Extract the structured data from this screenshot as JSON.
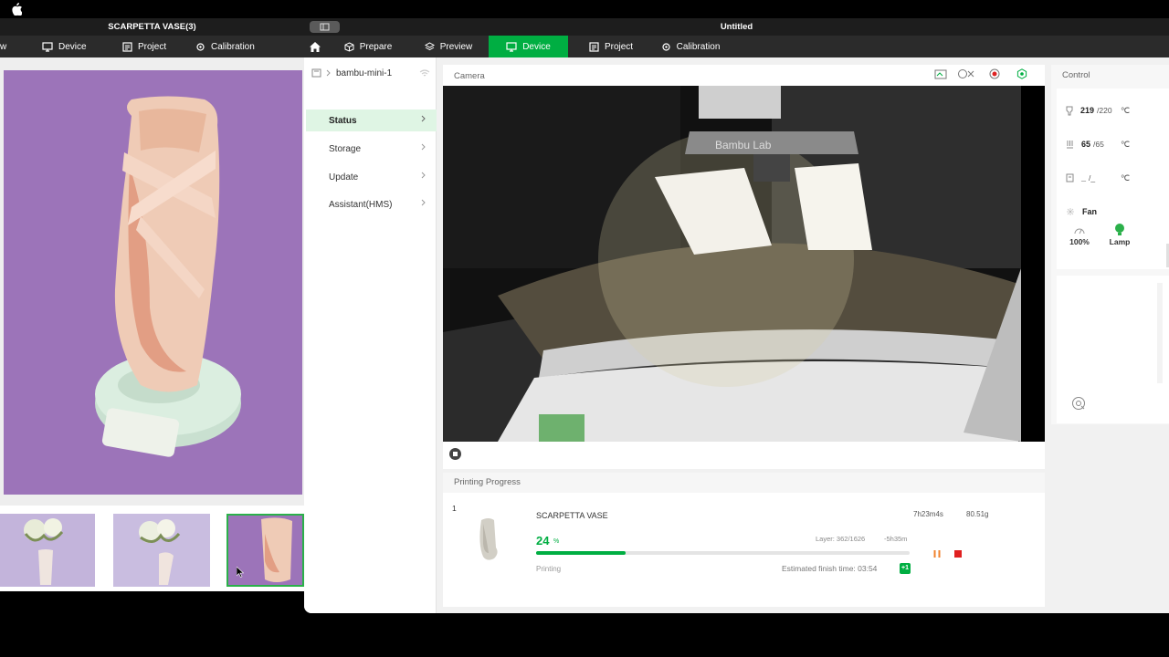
{
  "colors": {
    "accent_green": "#00ae42",
    "nav_bg": "#2b2b2b",
    "title_bg": "#1d1d1d",
    "photo_bg": "#9c74b9",
    "stop_red": "#e02020",
    "pause_orange": "#f0822c"
  },
  "left_window": {
    "title": "SCARPETTA VASE(3)",
    "nav": {
      "partial": "w",
      "device": "Device",
      "project": "Project",
      "calibration": "Calibration"
    }
  },
  "right_window": {
    "title": "Untitled",
    "tabs": {
      "prepare": "Prepare",
      "preview": "Preview",
      "device": "Device",
      "project": "Project",
      "calibration": "Calibration"
    },
    "device_selector": {
      "name": "bambu-mini-1"
    },
    "device_menu": [
      {
        "label": "Status",
        "active": true
      },
      {
        "label": "Storage",
        "active": false
      },
      {
        "label": "Update",
        "active": false
      },
      {
        "label": "Assistant(HMS)",
        "active": false
      }
    ],
    "camera": {
      "label": "Camera",
      "printer_brand_text": "Bambu Lab"
    },
    "printing_progress": {
      "header": "Printing Progress",
      "index": "1",
      "name": "SCARPETTA VASE",
      "time": "7h23m4s",
      "weight": "80.51g",
      "percent": "24",
      "percent_unit": "%",
      "progress_fraction": 0.24,
      "layer": "Layer: 362/1626",
      "remaining": "-5h35m",
      "status": "Printing",
      "finish": "Estimated finish time: 03:54",
      "finish_badge": "+1"
    },
    "control": {
      "label": "Control",
      "nozzle": {
        "current": "219",
        "target": "/220",
        "unit": "℃"
      },
      "bed": {
        "current": "65",
        "target": "/65",
        "unit": "℃"
      },
      "chamber": {
        "current": "_",
        "target": "/_",
        "unit": "℃"
      },
      "fan_label": "Fan",
      "fan_speed": "100%",
      "lamp_label": "Lamp"
    }
  }
}
